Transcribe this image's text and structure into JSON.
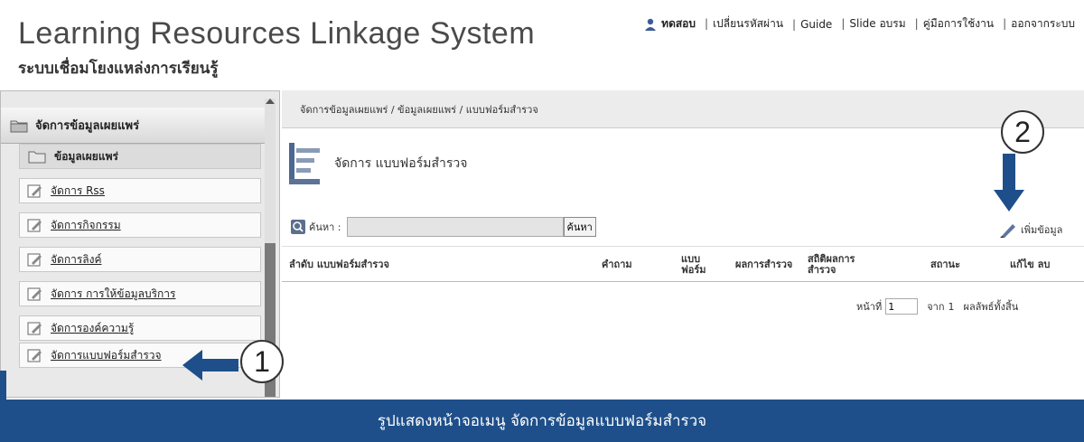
{
  "header": {
    "title": "Learning Resources Linkage System",
    "subtitle": "ระบบเชื่อมโยงแหล่งการเรียนรู้",
    "user": "ทดสอบ",
    "nav": [
      "เปลี่ยนรหัสผ่าน",
      "Guide",
      "Slide อบรม",
      "คู่มือการใช้งาน",
      "ออกจากระบบ"
    ]
  },
  "sidebar": {
    "section_label": "จัดการข้อมูลเผยแพร่",
    "items": [
      {
        "label": "ข้อมูลเผยแพร่",
        "icon": "folder-icon"
      },
      {
        "label": "จัดการ Rss",
        "icon": "edit-icon"
      },
      {
        "label": "จัดการกิจกรรม",
        "icon": "edit-icon"
      },
      {
        "label": "จัดการลิงค์",
        "icon": "edit-icon"
      },
      {
        "label": "จัดการ การให้ข้อมูลบริการ",
        "icon": "edit-icon"
      },
      {
        "label": "จัดการองค์ความรู้",
        "icon": "edit-icon"
      },
      {
        "label": "จัดการแบบฟอร์มสำรวจ",
        "icon": "edit-icon"
      }
    ]
  },
  "content": {
    "breadcrumb": "จัดการข้อมูลเผยแพร่ / ข้อมูลเผยแพร่ / แบบฟอร์มสำรวจ",
    "page_title": "จัดการ แบบฟอร์มสำรวจ",
    "search_label": "ค้นหา :",
    "search_value": "",
    "search_button": "ค้นหา",
    "add_label": "เพิ่มข้อมูล",
    "columns": {
      "order_name": "ลำดับ  แบบฟอร์มสำรวจ",
      "question": "คำถาม",
      "form_l1": "แบบ",
      "form_l2": "ฟอร์ม",
      "result": "ผลการสำรวจ",
      "stats_l1": "สถิติผลการ",
      "stats_l2": "สำรวจ",
      "status": "สถานะ",
      "actions": "แก้ไข  ลบ"
    },
    "pager": {
      "page_label": "หน้าที่",
      "page_value": "1",
      "of_label": "จาก",
      "of_value": "1",
      "total_label": "ผลลัพธ์ทั้งสิ้น"
    }
  },
  "annotations": {
    "step1": "1",
    "step2": "2"
  },
  "caption": "รูปแสดงหน้าจอเมนู จัดการข้อมูลแบบฟอร์มสำรวจ",
  "colors": {
    "caption_bg": "#1e4f8a",
    "arrow": "#1e4f8a"
  }
}
